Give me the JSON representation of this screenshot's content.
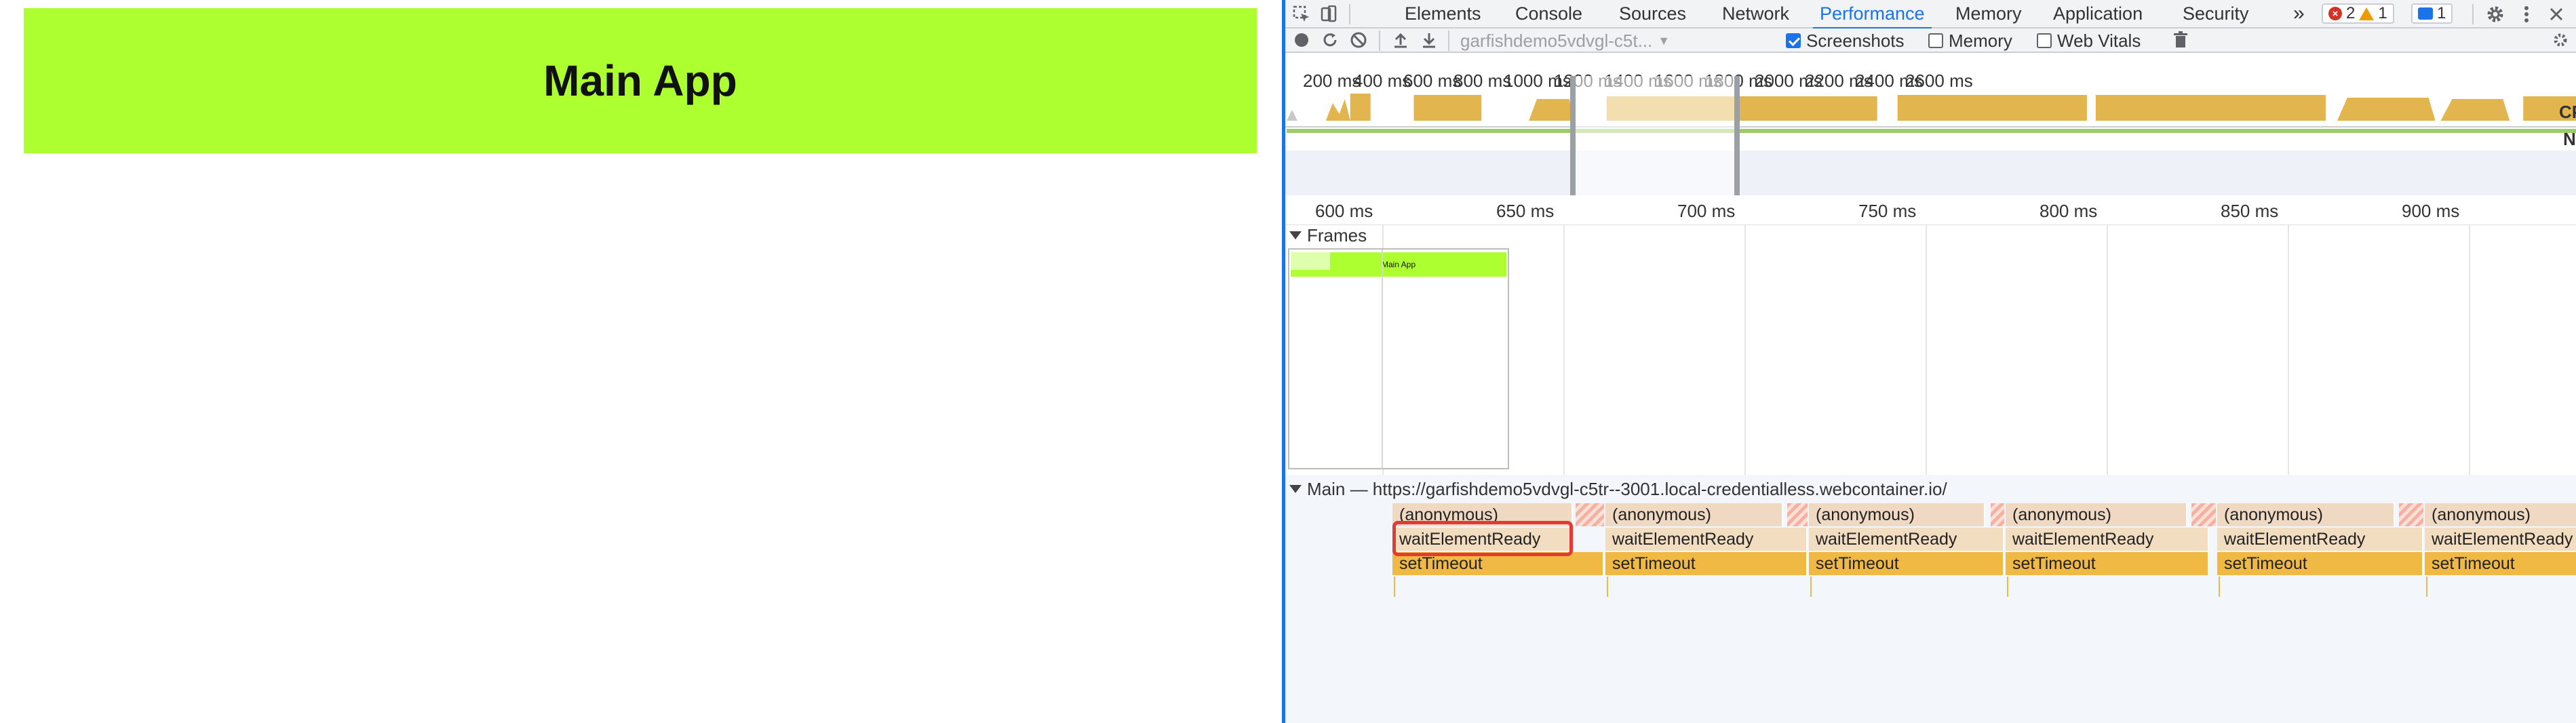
{
  "app": {
    "title": "Main App",
    "banner_color": "#adff2f"
  },
  "devtools": {
    "tabs": [
      "Elements",
      "Console",
      "Sources",
      "Network",
      "Performance",
      "Memory",
      "Application",
      "Security"
    ],
    "active_tab": "Performance",
    "more_tabs_label": "»",
    "counts": {
      "errors": "2",
      "warnings": "1",
      "messages": "1"
    },
    "accent_color": "#1a73e8",
    "perf_toolbar": {
      "recording_select": "garfishdemo5vdvgl-c5t...",
      "screenshots_label": "Screenshots",
      "screenshots_checked": true,
      "memory_label": "Memory",
      "memory_checked": false,
      "web_vitals_label": "Web Vitals",
      "web_vitals_checked": false
    },
    "overview_ticks": [
      "200 ms",
      "400 ms",
      "600 ms",
      "800 ms",
      "1000 ms",
      "1200 ms",
      "1400 ms",
      "1600 ms",
      "1800 ms",
      "2000 ms",
      "2200 ms",
      "2400 ms",
      "2600 ms"
    ],
    "overview_side_labels": [
      "CP",
      "N"
    ],
    "ruler_ticks": [
      "600 ms",
      "650 ms",
      "700 ms",
      "750 ms",
      "800 ms",
      "850 ms",
      "900 ms"
    ],
    "frames": {
      "section_label": "Frames",
      "thumbnail_title": "Main App"
    },
    "main_track": {
      "label": "Main — https://garfishdemo5vdvgl-c5tr--3001.local-credentialless.webcontainer.io/",
      "row1_label": "(anonymous)",
      "row2_label": "waitElementReady",
      "row3_label": "setTimeout"
    }
  }
}
